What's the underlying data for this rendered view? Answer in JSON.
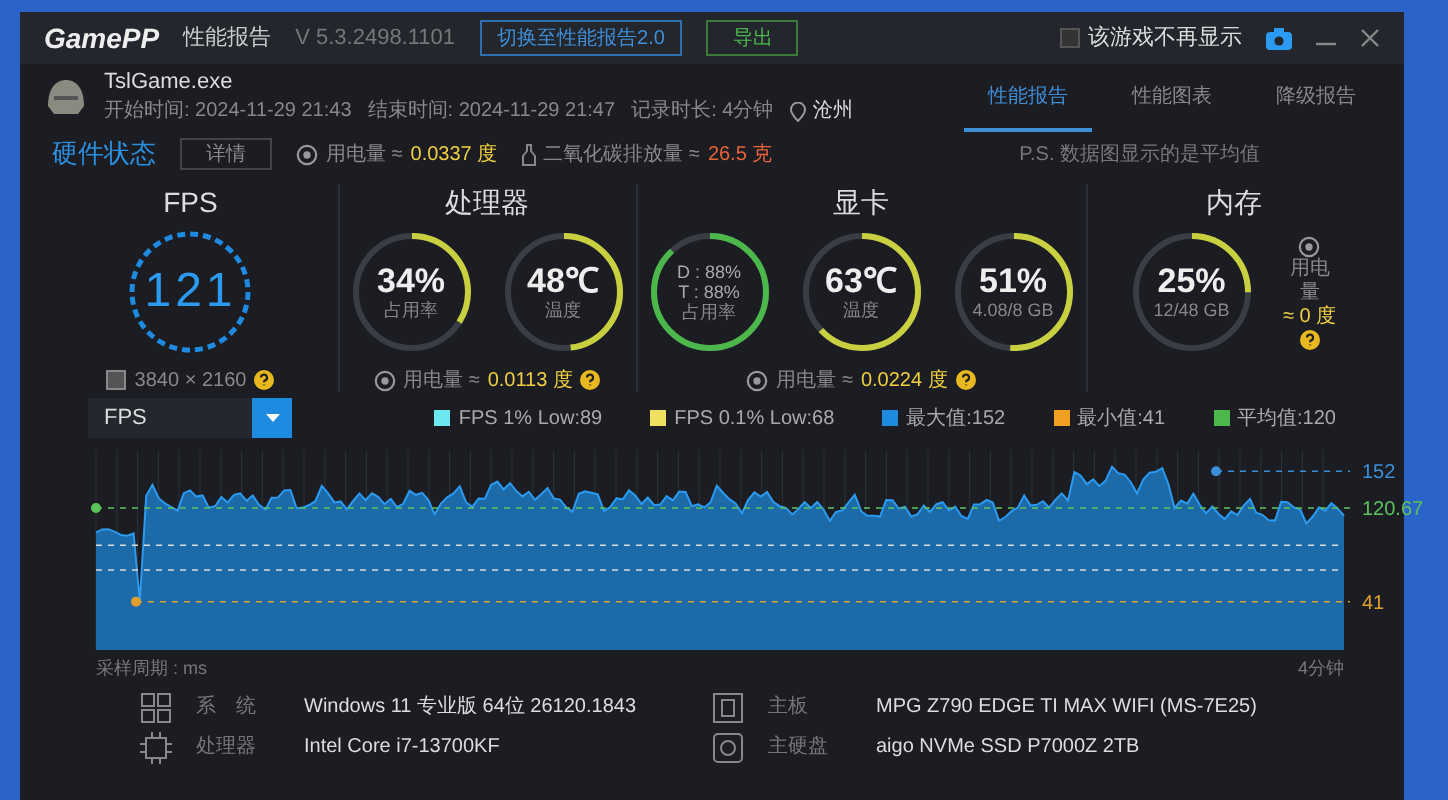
{
  "window": {
    "logo": "GamePP",
    "title": "性能报告",
    "version": "V 5.3.2498.1101",
    "switch_button": "切换至性能报告2.0",
    "export_button": "导出",
    "dont_show": {
      "label": "该游戏不再显示",
      "checked": false
    }
  },
  "session": {
    "game": "TslGame.exe",
    "start": "开始时间: 2024-11-29 21:43",
    "end": "结束时间: 2024-11-29 21:47",
    "duration": "记录时长: 4分钟",
    "location": "沧州"
  },
  "tabs": [
    {
      "label": "性能报告",
      "selected": true
    },
    {
      "label": "性能图表",
      "selected": false
    },
    {
      "label": "降级报告",
      "selected": false
    }
  ],
  "hardware": {
    "title": "硬件状态",
    "details_button": "详情",
    "power": {
      "label": "用电量 ≈",
      "value": "0.0337 度"
    },
    "co2": {
      "label": "二氧化碳排放量 ≈",
      "value": "26.5 克"
    },
    "note": "P.S. 数据图显示的是平均值"
  },
  "panels": [
    {
      "title": "FPS",
      "gauges": [
        {
          "kind": "fps",
          "value": "121"
        }
      ],
      "footer": {
        "kind": "resolution",
        "text": "3840 × 2160"
      }
    },
    {
      "title": "处理器",
      "gauges": [
        {
          "kind": "ring",
          "value": "34%",
          "caption": "占用率",
          "level": 0.34
        },
        {
          "kind": "ring",
          "value": "48℃",
          "caption": "温度",
          "level": 0.48
        }
      ],
      "footer": {
        "kind": "power",
        "label": "用电量 ≈",
        "value": "0.0113 度"
      }
    },
    {
      "title": "显卡",
      "gauges": [
        {
          "kind": "dual",
          "lines": [
            "D : 88%",
            "T : 88%"
          ],
          "caption": "占用率",
          "level": 0.88
        },
        {
          "kind": "ring",
          "value": "63℃",
          "caption": "温度",
          "level": 0.63
        },
        {
          "kind": "ring",
          "value": "51%",
          "caption": "4.08/8 GB",
          "level": 0.51
        }
      ],
      "footer": {
        "kind": "power",
        "label": "用电量 ≈",
        "value": "0.0224 度"
      }
    },
    {
      "title": "内存",
      "gauges": [
        {
          "kind": "ring",
          "value": "25%",
          "caption": "12/48 GB",
          "level": 0.25
        }
      ],
      "footer": {
        "kind": "side",
        "label": "用电量",
        "value": "≈ 0 度"
      }
    }
  ],
  "chart": {
    "metric_select": "FPS",
    "legend": [
      {
        "label": "FPS 1% Low:89",
        "color": "#6ee8f0"
      },
      {
        "label": "FPS 0.1% Low:68",
        "color": "#f0e060"
      },
      {
        "label": "最大值:152",
        "color": "#1e8ae0"
      },
      {
        "label": "最小值:41",
        "color": "#f0a020"
      },
      {
        "label": "平均值:120",
        "color": "#4cb84c"
      }
    ],
    "markers": [
      {
        "label": "152",
        "color": "#3b8fd8"
      },
      {
        "label": "120.67",
        "color": "#5cc35c"
      },
      {
        "label": "41",
        "color": "#e0a030"
      }
    ],
    "x_label_left": "采样周期 : ms",
    "x_label_right": "4分钟"
  },
  "specs": [
    {
      "kind": "windows",
      "label": "系　统",
      "value": "Windows 11 专业版 64位 26120.1843"
    },
    {
      "kind": "board",
      "label": "主板",
      "value": "MPG Z790 EDGE TI MAX WIFI (MS-7E25)"
    },
    {
      "kind": "cpu",
      "label": "处理器",
      "value": "Intel Core i7-13700KF"
    },
    {
      "kind": "disk",
      "label": "主硬盘",
      "value": "aigo NVMe SSD P7000Z 2TB"
    }
  ]
}
